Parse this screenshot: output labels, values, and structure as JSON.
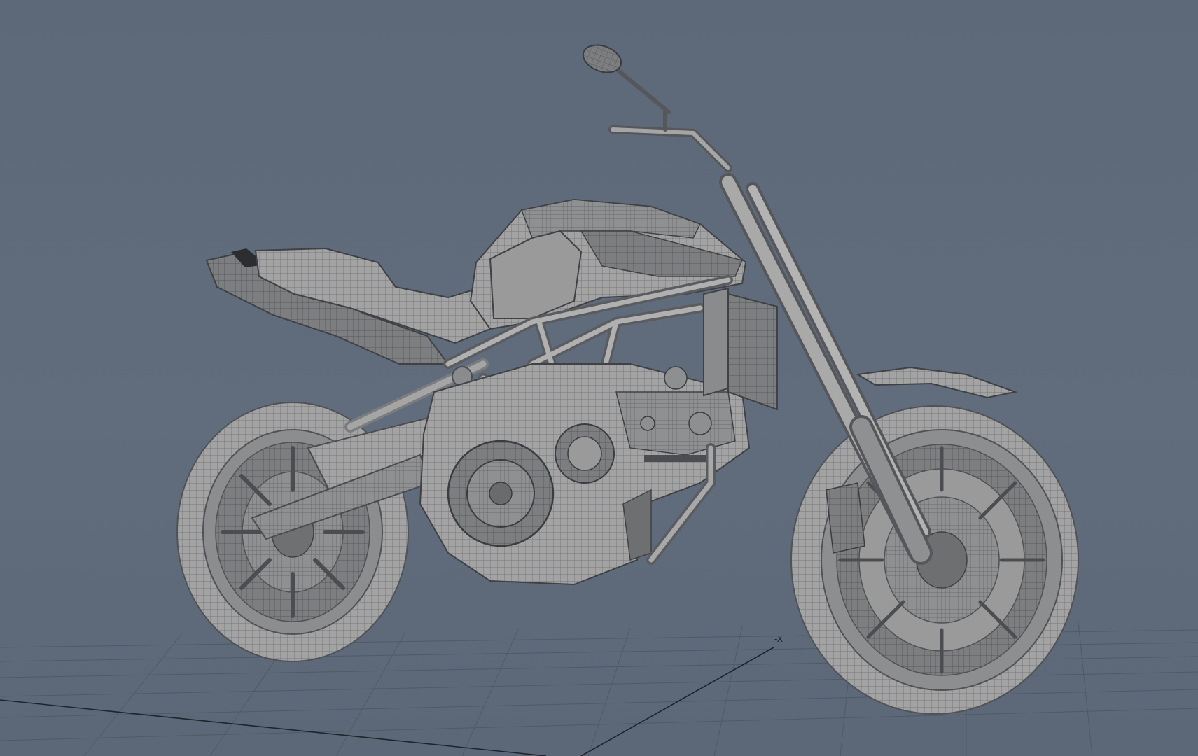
{
  "viewport": {
    "background": "#5f6b7b",
    "grid_color": "#4e5966",
    "mesh_fill": "#9c9c9c",
    "mesh_line": "#3c3f44",
    "axis_label": "-X"
  },
  "scene": {
    "object": "motorcycle-model",
    "display_mode": "wireframe-on-shaded"
  }
}
